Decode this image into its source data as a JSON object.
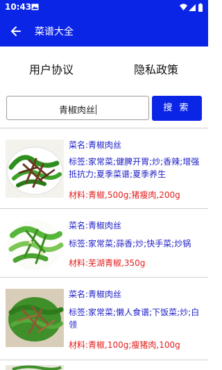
{
  "status_bar": {
    "time": "10:43",
    "icons": [
      "image-icon",
      "wifi-icon",
      "signal-icon",
      "battery-icon"
    ]
  },
  "app_bar": {
    "back_icon": "arrow-left-icon",
    "title": "菜谱大全"
  },
  "links": {
    "user_agreement": "用户协议",
    "privacy_policy": "隐私政策"
  },
  "search": {
    "value": "青椒肉丝",
    "button_label": "搜 索"
  },
  "colors": {
    "primary": "#0b25e6",
    "name_text": "#1c1cc8",
    "material_text": "#e31c1c"
  },
  "recipes": [
    {
      "name": "菜名:青椒肉丝",
      "tags": "标签:家常菜;健脾开胃;炒;香辣;增强抵抗力;夏季菜谱;夏季养生",
      "material": "材料:青椒,500g;猪瘦肉,200g"
    },
    {
      "name": "菜名:青椒肉丝",
      "tags": "标签:家常菜;蒜香;炒;快手菜;炒锅",
      "material": "材料:芜湖青椒,350g"
    },
    {
      "name": "菜名:青椒肉丝",
      "tags": "标签:家常菜;懒人食谱;下饭菜;炒;白领",
      "material": "材料:青椒,100g;瘦猪肉,100g"
    }
  ]
}
